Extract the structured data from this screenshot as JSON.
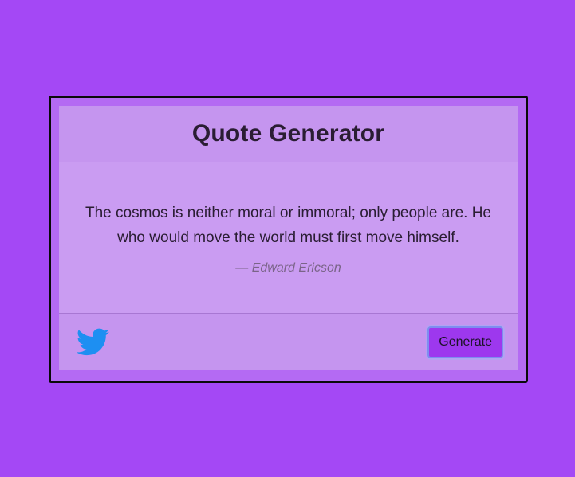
{
  "header": {
    "title": "Quote Generator"
  },
  "quote": {
    "text": "The cosmos is neither moral or immoral; only people are. He who would move the world must first move himself.",
    "author": "— Edward Ericson"
  },
  "footer": {
    "share_icon": "twitter-icon",
    "generate_label": "Generate"
  },
  "colors": {
    "background": "#a448f5",
    "card": "#ca9cf2",
    "twitter": "#1d8ff2",
    "button": "#9d38ee"
  }
}
